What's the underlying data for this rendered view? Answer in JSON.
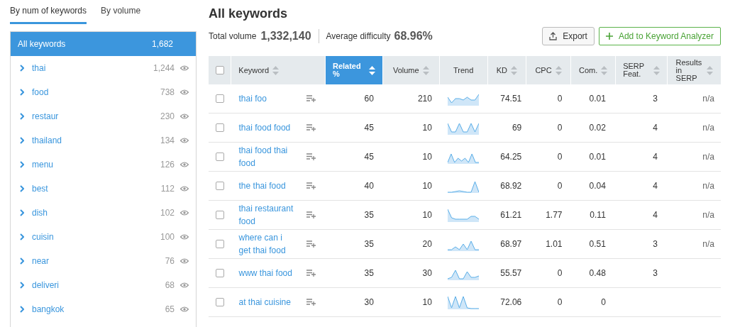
{
  "sidebar": {
    "tabs": [
      {
        "label": "By num of keywords",
        "selected": true
      },
      {
        "label": "By volume",
        "selected": false
      }
    ],
    "items": [
      {
        "label": "All keywords",
        "count": "1,682",
        "selected": true
      },
      {
        "label": "thai",
        "count": "1,244",
        "selected": false
      },
      {
        "label": "food",
        "count": "738",
        "selected": false
      },
      {
        "label": "restaur",
        "count": "230",
        "selected": false
      },
      {
        "label": "thailand",
        "count": "134",
        "selected": false
      },
      {
        "label": "menu",
        "count": "126",
        "selected": false
      },
      {
        "label": "best",
        "count": "112",
        "selected": false
      },
      {
        "label": "dish",
        "count": "102",
        "selected": false
      },
      {
        "label": "cuisin",
        "count": "100",
        "selected": false
      },
      {
        "label": "near",
        "count": "76",
        "selected": false
      },
      {
        "label": "deliveri",
        "count": "68",
        "selected": false
      },
      {
        "label": "bangkok",
        "count": "65",
        "selected": false
      }
    ]
  },
  "main": {
    "title": "All keywords",
    "total_volume_label": "Total volume",
    "total_volume": "1,332,140",
    "difficulty_label": "Average difficulty",
    "difficulty": "68.96%",
    "buttons": [
      {
        "label": "Export",
        "kind": "export"
      },
      {
        "label": "Add to Keyword Analyzer",
        "kind": "add"
      }
    ]
  },
  "table": {
    "select_all_checked": false,
    "columns": [
      {
        "label": "Keyword",
        "sortable": true,
        "selected": false
      },
      {
        "label": "Related %",
        "sortable": true,
        "selected": true
      },
      {
        "label": "Volume",
        "sortable": true,
        "selected": false
      },
      {
        "label": "Trend",
        "sortable": false,
        "selected": false
      },
      {
        "label": "KD",
        "sortable": true,
        "selected": false
      },
      {
        "label": "CPC",
        "sortable": true,
        "selected": false
      },
      {
        "label": "Com.",
        "sortable": true,
        "selected": false
      },
      {
        "label": "SERP Feat.",
        "sortable": true,
        "selected": false
      },
      {
        "label": "Results in SERP",
        "sortable": true,
        "selected": false
      }
    ],
    "rows": [
      {
        "keyword": "thai foo",
        "related": "60",
        "volume": "210",
        "kd": "74.51",
        "cpc": "0",
        "com": "0.01",
        "serp": "3",
        "results": "n/a",
        "checked": false
      },
      {
        "keyword": "thai food food",
        "related": "45",
        "volume": "10",
        "kd": "69",
        "cpc": "0",
        "com": "0.02",
        "serp": "4",
        "results": "n/a",
        "checked": false
      },
      {
        "keyword": "thai food thai food",
        "related": "45",
        "volume": "10",
        "kd": "64.25",
        "cpc": "0",
        "com": "0.01",
        "serp": "4",
        "results": "n/a",
        "checked": false
      },
      {
        "keyword": "the thai food",
        "related": "40",
        "volume": "10",
        "kd": "68.92",
        "cpc": "0",
        "com": "0.04",
        "serp": "4",
        "results": "n/a",
        "checked": false
      },
      {
        "keyword": "thai restaurant food",
        "related": "35",
        "volume": "10",
        "kd": "61.21",
        "cpc": "1.77",
        "com": "0.11",
        "serp": "4",
        "results": "n/a",
        "checked": false
      },
      {
        "keyword": "where can i get thai food",
        "related": "35",
        "volume": "20",
        "kd": "68.97",
        "cpc": "1.01",
        "com": "0.51",
        "serp": "3",
        "results": "n/a",
        "checked": false
      },
      {
        "keyword": "www thai food",
        "related": "35",
        "volume": "30",
        "kd": "55.57",
        "cpc": "0",
        "com": "0.48",
        "serp": "3",
        "checked": false
      },
      {
        "keyword": "at thai cuisine",
        "related": "30",
        "volume": "10",
        "kd": "72.06",
        "cpc": "0",
        "com": "0",
        "checked": false
      }
    ]
  }
}
